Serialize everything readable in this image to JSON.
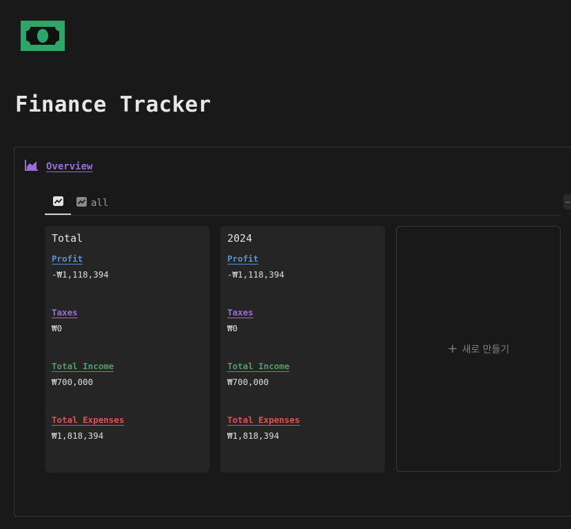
{
  "page": {
    "icon": "banknote-icon",
    "title": "Finance Tracker"
  },
  "database": {
    "icon": "area-chart-icon",
    "title": "Overview",
    "tabs": [
      {
        "label": "",
        "icon": "trend-chart-icon",
        "active": true
      },
      {
        "label": "all",
        "icon": "trend-chart-icon",
        "active": false
      }
    ],
    "cards": [
      {
        "name": "Total",
        "properties": [
          {
            "label": "Profit",
            "value": "-₩1,118,394"
          },
          {
            "label": "Taxes",
            "value": "₩0"
          },
          {
            "label": "Total Income",
            "value": "₩700,000"
          },
          {
            "label": "Total Expenses",
            "value": "₩1,818,394"
          }
        ]
      },
      {
        "name": "2024",
        "properties": [
          {
            "label": "Profit",
            "value": "-₩1,118,394"
          },
          {
            "label": "Taxes",
            "value": "₩0"
          },
          {
            "label": "Total Income",
            "value": "₩700,000"
          },
          {
            "label": "Total Expenses",
            "value": "₩1,818,394"
          }
        ]
      }
    ],
    "new_card_label": "새로 만들기",
    "property_colors": {
      "Profit": "#5d8fd8",
      "Taxes": "#9a6dd7",
      "Total Income": "#4f9a6b",
      "Total Expenses": "#e05252"
    }
  },
  "colors": {
    "background": "#191919",
    "icon_green": "#2ea66a",
    "accent_purple": "#9a6dd7"
  }
}
